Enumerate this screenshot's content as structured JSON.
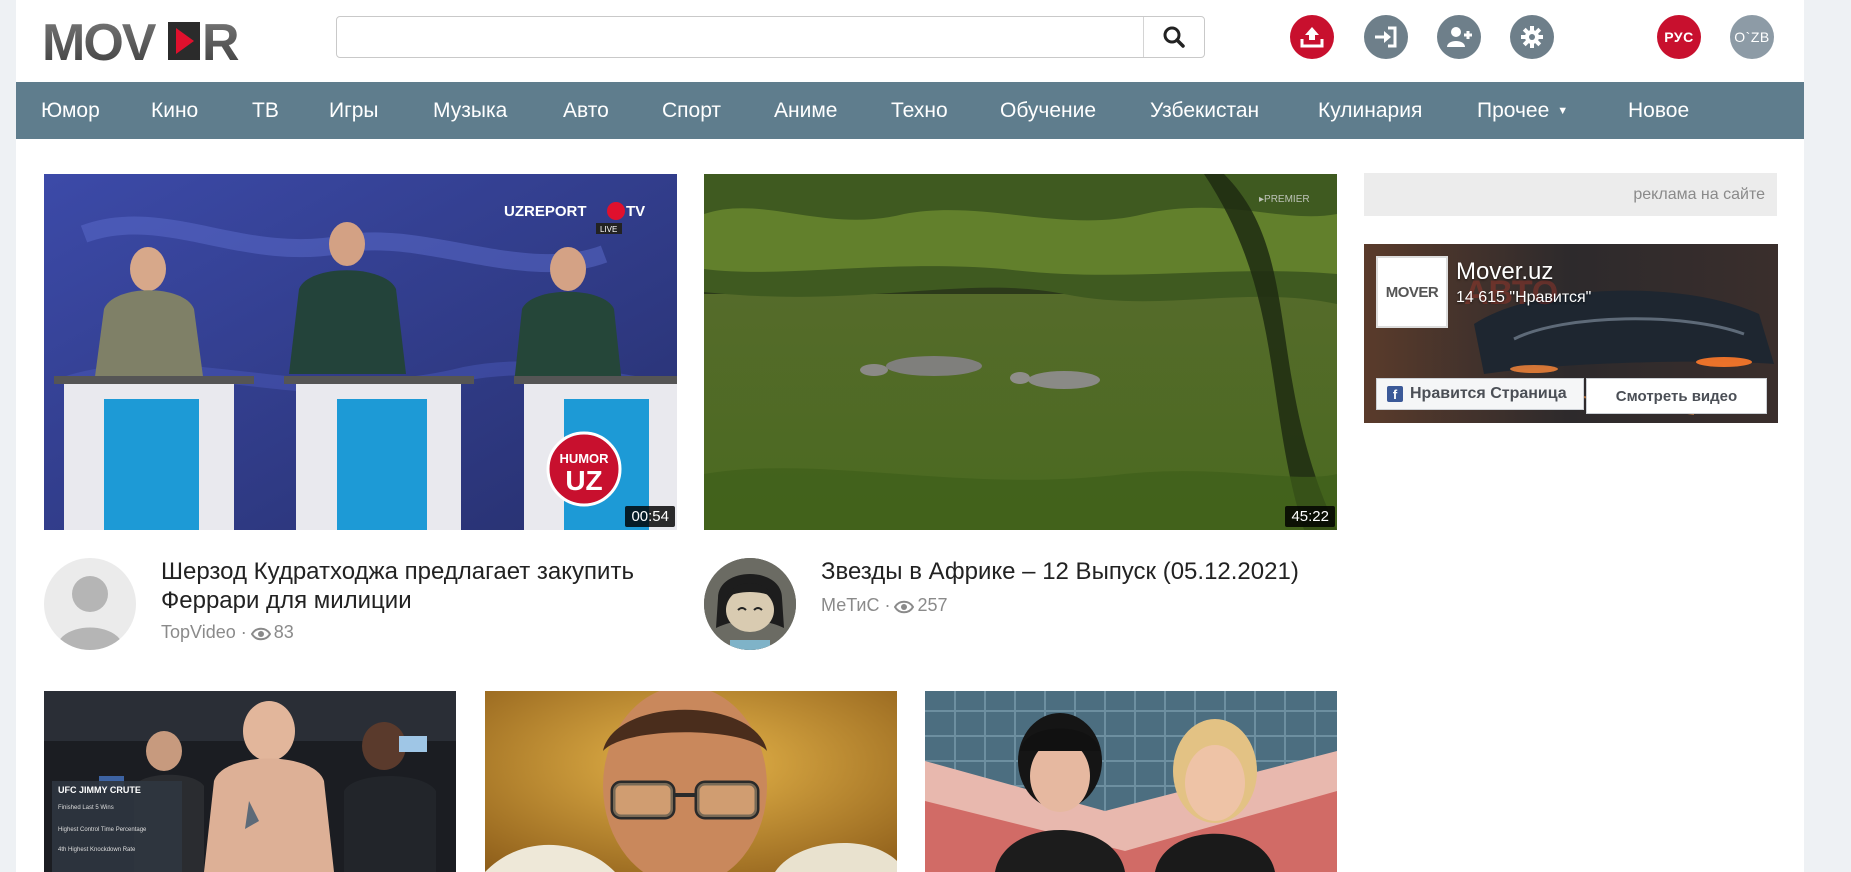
{
  "header": {
    "logo_text": "MOVER",
    "search": {
      "value": "",
      "placeholder": ""
    },
    "buttons": {
      "upload": "upload-icon",
      "login": "sign-in-icon",
      "register": "add-user-icon",
      "settings": "gear-icon"
    },
    "lang_ru": "РУС",
    "lang_uz": "O`ZB"
  },
  "nav": {
    "items": [
      "Юмор",
      "Кино",
      "ТВ",
      "Игры",
      "Музыка",
      "Авто",
      "Спорт",
      "Аниме",
      "Техно",
      "Обучение",
      "Узбекистан",
      "Кулинария",
      "Прочее",
      "Новое"
    ],
    "dropdown_item": "Прочее"
  },
  "videos": [
    {
      "title": "Шерзод Кудратходжа предлагает закупить Феррари для милиции",
      "author": "TopVideo",
      "views": "83",
      "duration": "00:54",
      "channel_logo": "UZREPORT TV",
      "badge": "HUMOR UZ"
    },
    {
      "title": "Звезды в Африке – 12 Выпуск (05.12.2021)",
      "author": "МеТиС",
      "views": "257",
      "duration": "45:22",
      "channel_logo": "PREMIER"
    }
  ],
  "sidebar": {
    "ad_link": "реклама на сайте",
    "fb": {
      "page_name": "Mover.uz",
      "likes": "14 615 \"Нравится\"",
      "like_button": "Нравится Страница",
      "watch_button": "Смотреть видео",
      "logo_text": "MOVER"
    }
  },
  "colors": {
    "nav_bg": "#5f7d8d",
    "accent_red": "#c8102e",
    "icon_gray": "#6e7f8a"
  }
}
